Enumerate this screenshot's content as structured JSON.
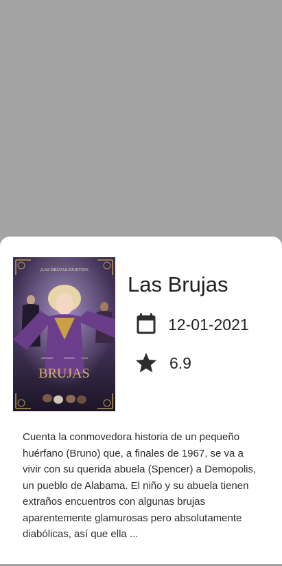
{
  "movie": {
    "title": "Las Brujas",
    "release_date": "12-01-2021",
    "rating": "6.9",
    "overview": "Cuenta la conmovedora historia de un pequeño huérfano (Bruno) que, a finales de 1967, se va a vivir con su querida abuela (Spencer) a Demopolis, un pueblo de Alabama. El niño y su abuela tienen extraños encuentros con algunas brujas aparentemente glamurosas pero absolutamente diabólicas, así que ella ..."
  },
  "poster": {
    "tagline": "¡LAS BRUJAS EXISTEN!",
    "title_art": "BRUJAS",
    "credits": [
      "HATHAWAY",
      "SPENCER",
      "TUCCI"
    ]
  },
  "icons": {
    "date": "calendar-icon",
    "rating": "star-icon"
  },
  "colors": {
    "scrim": "#a3a3a3",
    "sheet": "#ffffff",
    "text": "#1f1f1f",
    "icon": "#2d2d2d"
  }
}
